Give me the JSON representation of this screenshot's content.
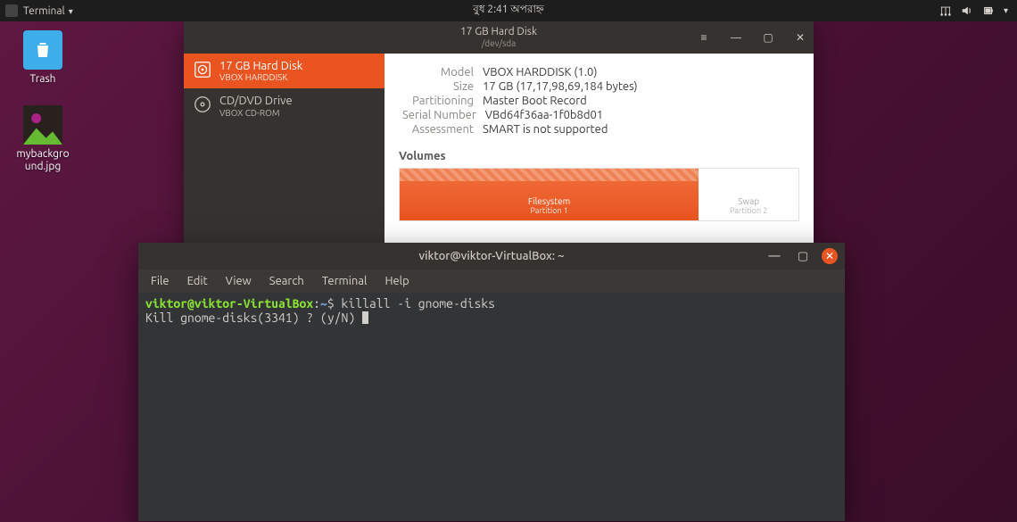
{
  "top_panel": {
    "app_label": "Terminal",
    "clock": "বুধ  2:41 অপরাহ্ন"
  },
  "desktop": {
    "trash_label": "Trash",
    "image_label": "mybackgro\nund.jpg"
  },
  "disks": {
    "title": "17 GB Hard Disk",
    "subtitle": "/dev/sda",
    "sidebar": [
      {
        "name": "17 GB Hard Disk",
        "sub": "VBOX HARDDISK"
      },
      {
        "name": "CD/DVD Drive",
        "sub": "VBOX CD-ROM"
      }
    ],
    "info": {
      "model_k": "Model",
      "model_v": "VBOX HARDDISK (1.0)",
      "size_k": "Size",
      "size_v": "17 GB (17,17,98,69,184 bytes)",
      "part_k": "Partitioning",
      "part_v": "Master Boot Record",
      "serial_k": "Serial Number",
      "serial_v": "VBd64f36aa-1f0b8d01",
      "assess_k": "Assessment",
      "assess_v": "SMART is not supported"
    },
    "volumes_label": "Volumes",
    "volumes": [
      {
        "line1": "Filesystem",
        "line2": "Partition 1"
      },
      {
        "line1": "Swap",
        "line2": "Partition 2"
      }
    ]
  },
  "terminal": {
    "title": "viktor@viktor-VirtualBox: ~",
    "menu": [
      "File",
      "Edit",
      "View",
      "Search",
      "Terminal",
      "Help"
    ],
    "prompt_user": "viktor@viktor-VirtualBox",
    "prompt_colon": ":",
    "prompt_path": "~",
    "prompt_dollar": "$",
    "command": "killall -i gnome-disks",
    "output": "Kill gnome-disks(3341) ? (y/N) "
  }
}
